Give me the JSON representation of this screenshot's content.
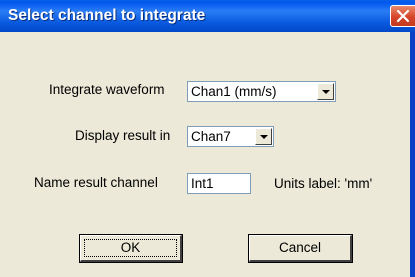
{
  "window": {
    "title": "Select channel to integrate"
  },
  "form": {
    "integrate_label": "Integrate waveform",
    "integrate_value": "Chan1 (mm/s)",
    "display_label": "Display result in",
    "display_value": "Chan7",
    "name_label": "Name result channel",
    "name_value": "Int1",
    "units_text": "Units label:  'mm'"
  },
  "buttons": {
    "ok_label": "OK",
    "cancel_label": "Cancel"
  },
  "icons": [
    "close-icon",
    "dropdown-arrow-icon"
  ],
  "colors": {
    "titlebar": "#0058ee",
    "close": "#d6452a",
    "face": "#ece9d8"
  }
}
